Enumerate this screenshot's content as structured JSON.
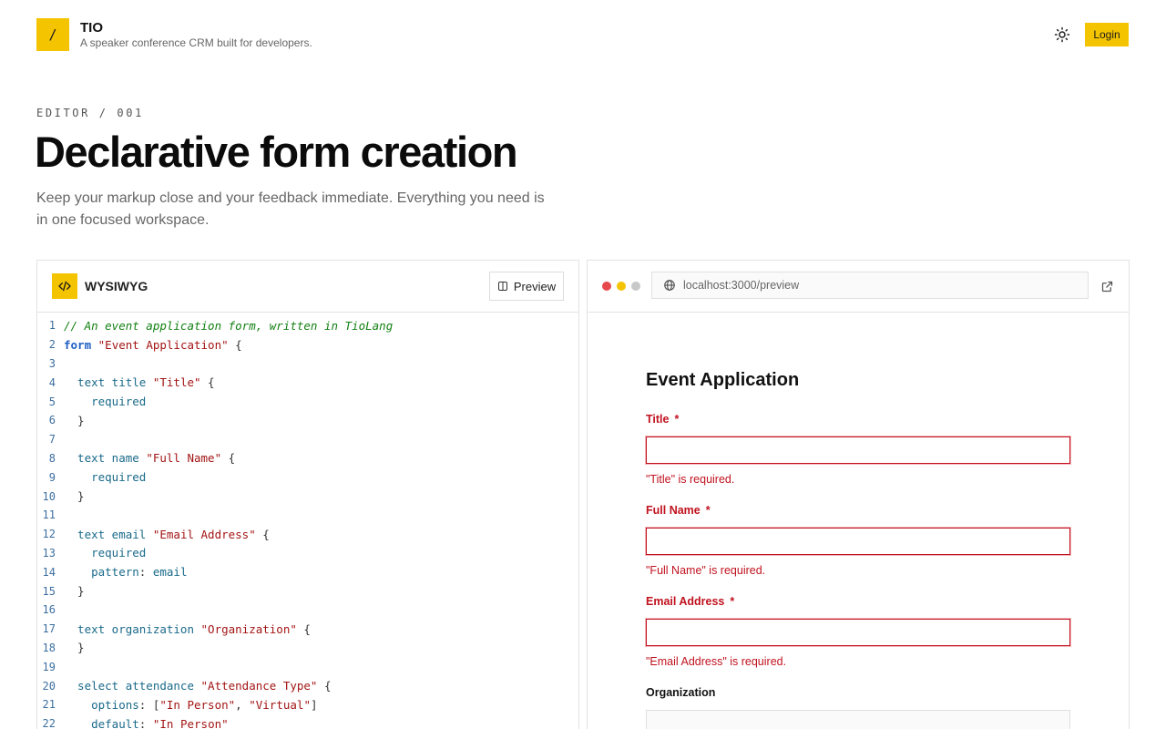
{
  "header": {
    "logo_glyph": "/",
    "brand_name": "TIO",
    "tagline": "A speaker conference CRM built for developers.",
    "login_label": "Login",
    "theme_icon": "sun-icon"
  },
  "hero": {
    "eyebrow": "EDITOR / 001",
    "title": "Declarative form creation",
    "subtitle": "Keep your markup close and your feedback immediate. Everything you need is in one focused workspace."
  },
  "editor": {
    "title": "WYSIWYG",
    "preview_button": "Preview",
    "lines": [
      {
        "n": "1",
        "tokens": [
          {
            "t": "// An event application form, written in TioLang",
            "c": "comment"
          }
        ]
      },
      {
        "n": "2",
        "tokens": [
          {
            "t": "form",
            "c": "kw"
          },
          {
            "t": " ",
            "c": "plain"
          },
          {
            "t": "\"Event Application\"",
            "c": "str"
          },
          {
            "t": " {",
            "c": "plain"
          }
        ]
      },
      {
        "n": "3",
        "tokens": []
      },
      {
        "n": "4",
        "tokens": [
          {
            "t": "  text title ",
            "c": "type"
          },
          {
            "t": "\"Title\"",
            "c": "str"
          },
          {
            "t": " {",
            "c": "plain"
          }
        ]
      },
      {
        "n": "5",
        "tokens": [
          {
            "t": "    required",
            "c": "type"
          }
        ]
      },
      {
        "n": "6",
        "tokens": [
          {
            "t": "  }",
            "c": "plain"
          }
        ]
      },
      {
        "n": "7",
        "tokens": []
      },
      {
        "n": "8",
        "tokens": [
          {
            "t": "  text name ",
            "c": "type"
          },
          {
            "t": "\"Full Name\"",
            "c": "str"
          },
          {
            "t": " {",
            "c": "plain"
          }
        ]
      },
      {
        "n": "9",
        "tokens": [
          {
            "t": "    required",
            "c": "type"
          }
        ]
      },
      {
        "n": "10",
        "tokens": [
          {
            "t": "  }",
            "c": "plain"
          }
        ]
      },
      {
        "n": "11",
        "tokens": []
      },
      {
        "n": "12",
        "tokens": [
          {
            "t": "  text email ",
            "c": "type"
          },
          {
            "t": "\"Email Address\"",
            "c": "str"
          },
          {
            "t": " {",
            "c": "plain"
          }
        ]
      },
      {
        "n": "13",
        "tokens": [
          {
            "t": "    required",
            "c": "type"
          }
        ]
      },
      {
        "n": "14",
        "tokens": [
          {
            "t": "    pattern",
            "c": "type"
          },
          {
            "t": ": ",
            "c": "plain"
          },
          {
            "t": "email",
            "c": "type"
          }
        ]
      },
      {
        "n": "15",
        "tokens": [
          {
            "t": "  }",
            "c": "plain"
          }
        ]
      },
      {
        "n": "16",
        "tokens": []
      },
      {
        "n": "17",
        "tokens": [
          {
            "t": "  text organization ",
            "c": "type"
          },
          {
            "t": "\"Organization\"",
            "c": "str"
          },
          {
            "t": " {",
            "c": "plain"
          }
        ]
      },
      {
        "n": "18",
        "tokens": [
          {
            "t": "  }",
            "c": "plain"
          }
        ]
      },
      {
        "n": "19",
        "tokens": []
      },
      {
        "n": "20",
        "tokens": [
          {
            "t": "  select attendance ",
            "c": "type"
          },
          {
            "t": "\"Attendance Type\"",
            "c": "str"
          },
          {
            "t": " {",
            "c": "plain"
          }
        ]
      },
      {
        "n": "21",
        "tokens": [
          {
            "t": "    options",
            "c": "type"
          },
          {
            "t": ": [",
            "c": "plain"
          },
          {
            "t": "\"In Person\"",
            "c": "str"
          },
          {
            "t": ", ",
            "c": "plain"
          },
          {
            "t": "\"Virtual\"",
            "c": "str"
          },
          {
            "t": "]",
            "c": "plain"
          }
        ]
      },
      {
        "n": "22",
        "tokens": [
          {
            "t": "    default",
            "c": "type"
          },
          {
            "t": ": ",
            "c": "plain"
          },
          {
            "t": "\"In Person\"",
            "c": "str"
          }
        ]
      }
    ]
  },
  "preview": {
    "url": "localhost:3000/preview",
    "form_title": "Event Application",
    "fields": [
      {
        "label": "Title",
        "required_mark": "*",
        "error": "\"Title\" is required."
      },
      {
        "label": "Full Name",
        "required_mark": "*",
        "error": "\"Full Name\" is required."
      },
      {
        "label": "Email Address",
        "required_mark": "*",
        "error": "\"Email Address\" is required."
      }
    ],
    "org_label": "Organization"
  },
  "colors": {
    "accent": "#f5c400",
    "error": "#c0121f"
  }
}
